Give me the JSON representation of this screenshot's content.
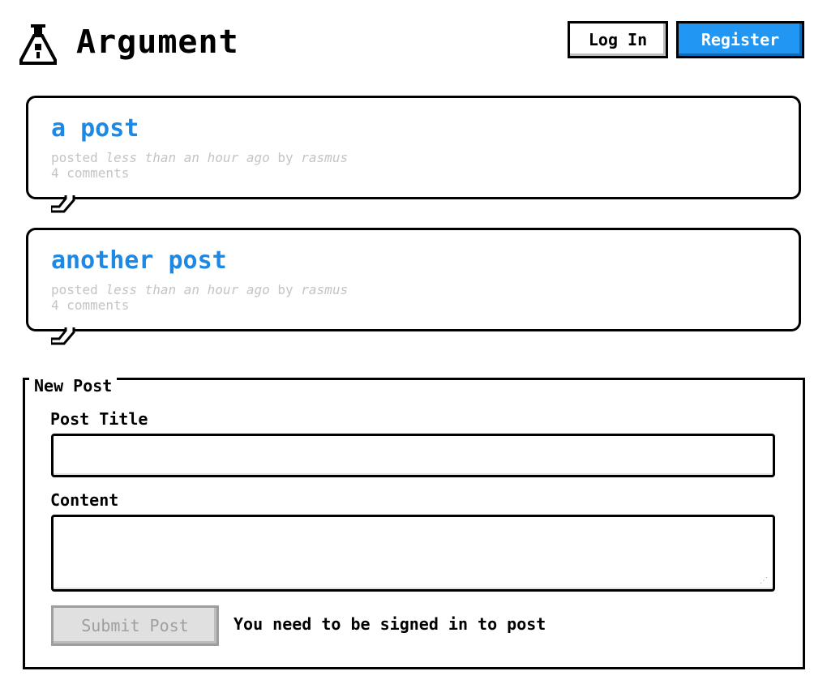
{
  "header": {
    "brand": "Argument",
    "login_label": "Log In",
    "register_label": "Register"
  },
  "posts": [
    {
      "title": "a post",
      "meta_prefix": "posted",
      "meta_time": "less than an hour ago",
      "meta_by": "by",
      "meta_author": "rasmus",
      "comments": "4 comments"
    },
    {
      "title": "another post",
      "meta_prefix": "posted",
      "meta_time": "less than an hour ago",
      "meta_by": "by",
      "meta_author": "rasmus",
      "comments": "4 comments"
    }
  ],
  "new_post": {
    "legend": "New Post",
    "title_label": "Post Title",
    "title_value": "",
    "content_label": "Content",
    "content_value": "",
    "submit_label": "Submit Post",
    "notice": "You need to be signed in to post"
  },
  "colors": {
    "accent": "#2196f3",
    "link": "#1e88e5",
    "muted": "#c4c4c4"
  },
  "icons": {
    "logo": "flask-icon"
  }
}
